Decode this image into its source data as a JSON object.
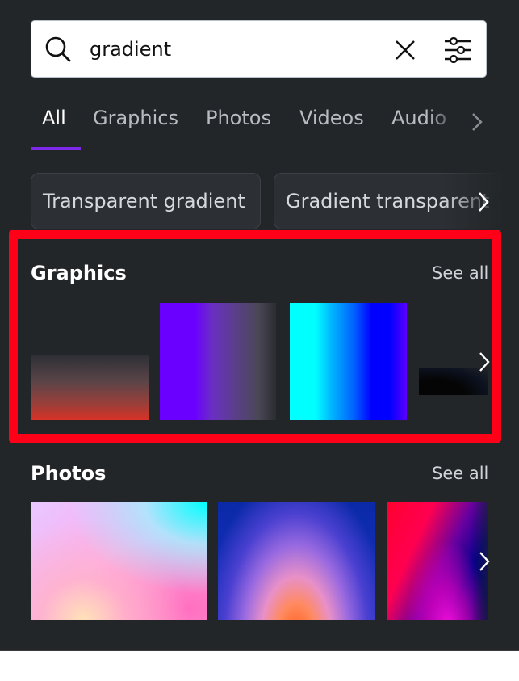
{
  "search": {
    "value": "gradient",
    "icon": "search-icon",
    "clear_icon": "close-icon",
    "filter_icon": "filter-sliders-icon"
  },
  "tabs": [
    {
      "label": "All",
      "active": true
    },
    {
      "label": "Graphics",
      "active": false
    },
    {
      "label": "Photos",
      "active": false
    },
    {
      "label": "Videos",
      "active": false
    },
    {
      "label": "Audio",
      "active": false
    }
  ],
  "suggestions": [
    {
      "label": "Transparent gradient"
    },
    {
      "label": "Gradient transparent"
    }
  ],
  "sections": {
    "graphics": {
      "title": "Graphics",
      "see_all": "See all",
      "items": [
        {
          "description": "dark to red vertical gradient"
        },
        {
          "description": "purple to dark horizontal gradient"
        },
        {
          "description": "cyan to blue horizontal gradient"
        },
        {
          "description": "black shadow gradient"
        }
      ]
    },
    "photos": {
      "title": "Photos",
      "see_all": "See all",
      "items": [
        {
          "description": "pastel pink and cyan gradient"
        },
        {
          "description": "blue purple orange sunset gradient"
        },
        {
          "description": "red magenta navy gradient"
        }
      ]
    }
  },
  "colors": {
    "accent": "#7d2ae8",
    "panel_bg": "#232629",
    "annotation": "#ff0019"
  }
}
